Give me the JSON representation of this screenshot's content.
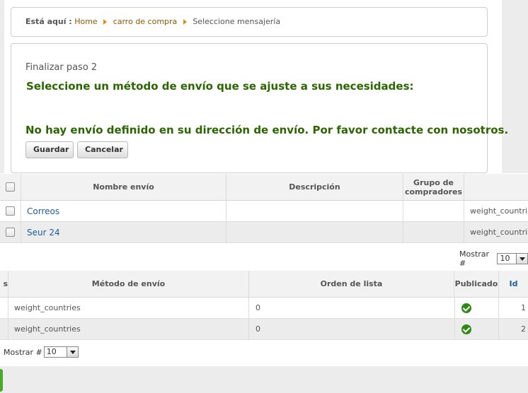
{
  "breadcrumb": {
    "lead": "Está aquí :",
    "items": [
      "Home",
      "carro de compra"
    ],
    "current": "Seleccione mensajería"
  },
  "checkout": {
    "step": "Finalizar paso 2",
    "heading": "Seleccione un método de envío que se ajuste a sus necesidades:",
    "notice": "No hay envío definido en su dirección de envío. Por favor contacte con nosotros.",
    "save_label": "Guardar",
    "cancel_label": "Cancelar"
  },
  "shipping_table": {
    "headers": [
      "Nombre envío",
      "Descripción",
      "Grupo de compradores"
    ],
    "rows": [
      {
        "name": "Correos",
        "description": "",
        "group": "",
        "method": "weight_countries"
      },
      {
        "name": "Seur 24",
        "description": "",
        "group": "",
        "method": "weight_countries"
      }
    ],
    "pager_label": "Mostrar #",
    "pager_value": "10"
  },
  "method_table": {
    "headers": [
      "s",
      "Método de envío",
      "Orden de lista",
      "Publicado",
      "Id"
    ],
    "rows": [
      {
        "method": "weight_countries",
        "order": "0",
        "id": "1"
      },
      {
        "method": "weight_countries",
        "order": "0",
        "id": "2"
      }
    ],
    "pager_label": "Mostrar #",
    "pager_value": "10"
  },
  "colors": {
    "heading_green": "#2b6600",
    "link_blue": "#1c5d9f",
    "breadcrumb_link": "#8b5a00",
    "published_icon": "#2d8a12"
  }
}
